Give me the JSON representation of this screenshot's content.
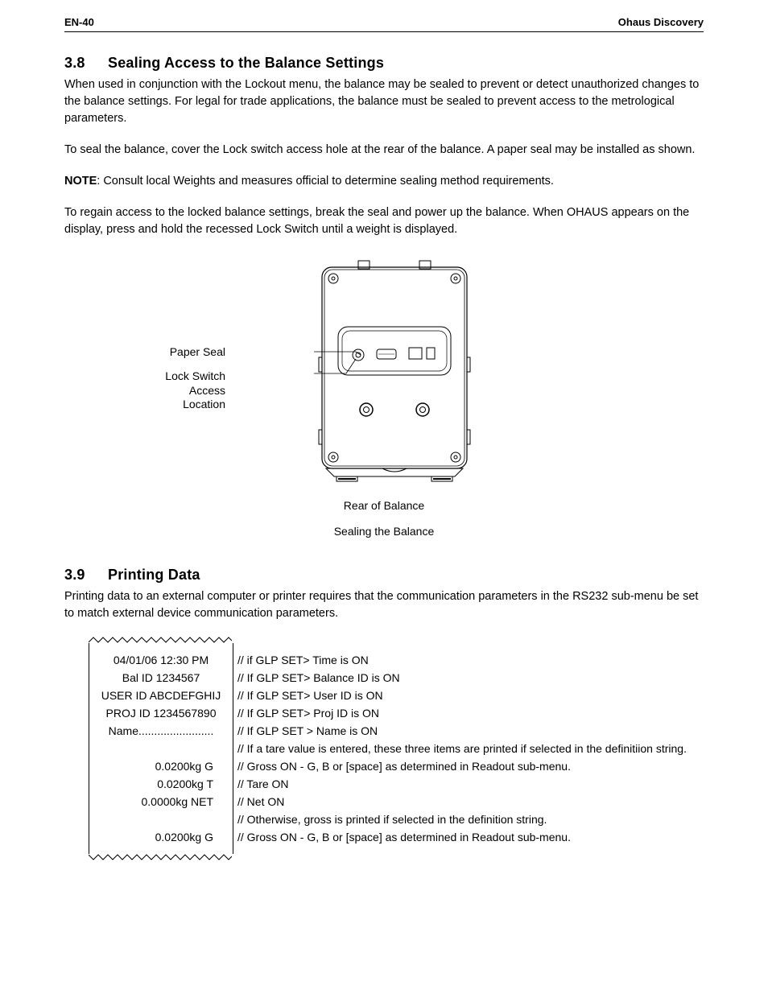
{
  "header": {
    "left": "EN-40",
    "right": "Ohaus Discovery"
  },
  "section38": {
    "num": "3.8",
    "title": "Sealing Access to the Balance Settings",
    "p1": "When used in conjunction with the Lockout menu, the balance may be sealed to prevent or detect unauthorized changes to the balance settings. For legal for trade applications, the balance must be sealed to prevent access to the metrological parameters.",
    "p2": "To seal the balance, cover the Lock switch access hole at the rear of the balance.  A paper seal may be installed as shown.",
    "noteLabel": "NOTE",
    "noteText": ": Consult local Weights and measures official to determine sealing method requirements.",
    "p3": "To regain access to the locked balance settings, break the seal and power up the balance.  When OHAUS appears on the display, press and hold the recessed Lock Switch until a weight is displayed."
  },
  "figure": {
    "callout1": "Paper Seal",
    "callout2a": "Lock Switch",
    "callout2b": "Access Location",
    "caption1": "Rear of Balance",
    "caption2": "Sealing the Balance"
  },
  "section39": {
    "num": "3.9",
    "title": "Printing Data",
    "p1": "Printing data to an external computer or printer requires that the communication parameters in the RS232 sub-menu be set to match external device communication parameters."
  },
  "printout": {
    "rows": [
      {
        "left": "04/01/06  12:30 PM",
        "align": "center",
        "right": "// if GLP SET> Time is ON"
      },
      {
        "left": "Bal ID 1234567",
        "align": "center",
        "right": "// If GLP SET> Balance ID is ON"
      },
      {
        "left": "USER ID ABCDEFGHIJ",
        "align": "center",
        "right": "// If GLP SET> User ID is ON"
      },
      {
        "left": "PROJ ID 1234567890",
        "align": "center",
        "right": "// If GLP SET> Proj ID is ON"
      },
      {
        "left": "Name........................",
        "align": "center",
        "right": "// If GLP SET > Name is ON"
      },
      {
        "left": "",
        "align": "center",
        "right": "// If a tare value is entered, these three items are printed if selected in the definitiion string."
      },
      {
        "left": "0.0200kg G",
        "align": "right",
        "right": "// Gross ON - G, B or [space] as determined in Readout sub-menu."
      },
      {
        "left": "0.0200kg T",
        "align": "right",
        "right": "// Tare ON"
      },
      {
        "left": "0.0000kg NET",
        "align": "right",
        "right": "// Net ON"
      },
      {
        "left": "",
        "align": "center",
        "right": "// Otherwise, gross is printed if selected in the definition string."
      },
      {
        "left": "0.0200kg G",
        "align": "right",
        "right": "// Gross ON - G, B or [space] as determined in Readout   sub-menu."
      }
    ]
  }
}
